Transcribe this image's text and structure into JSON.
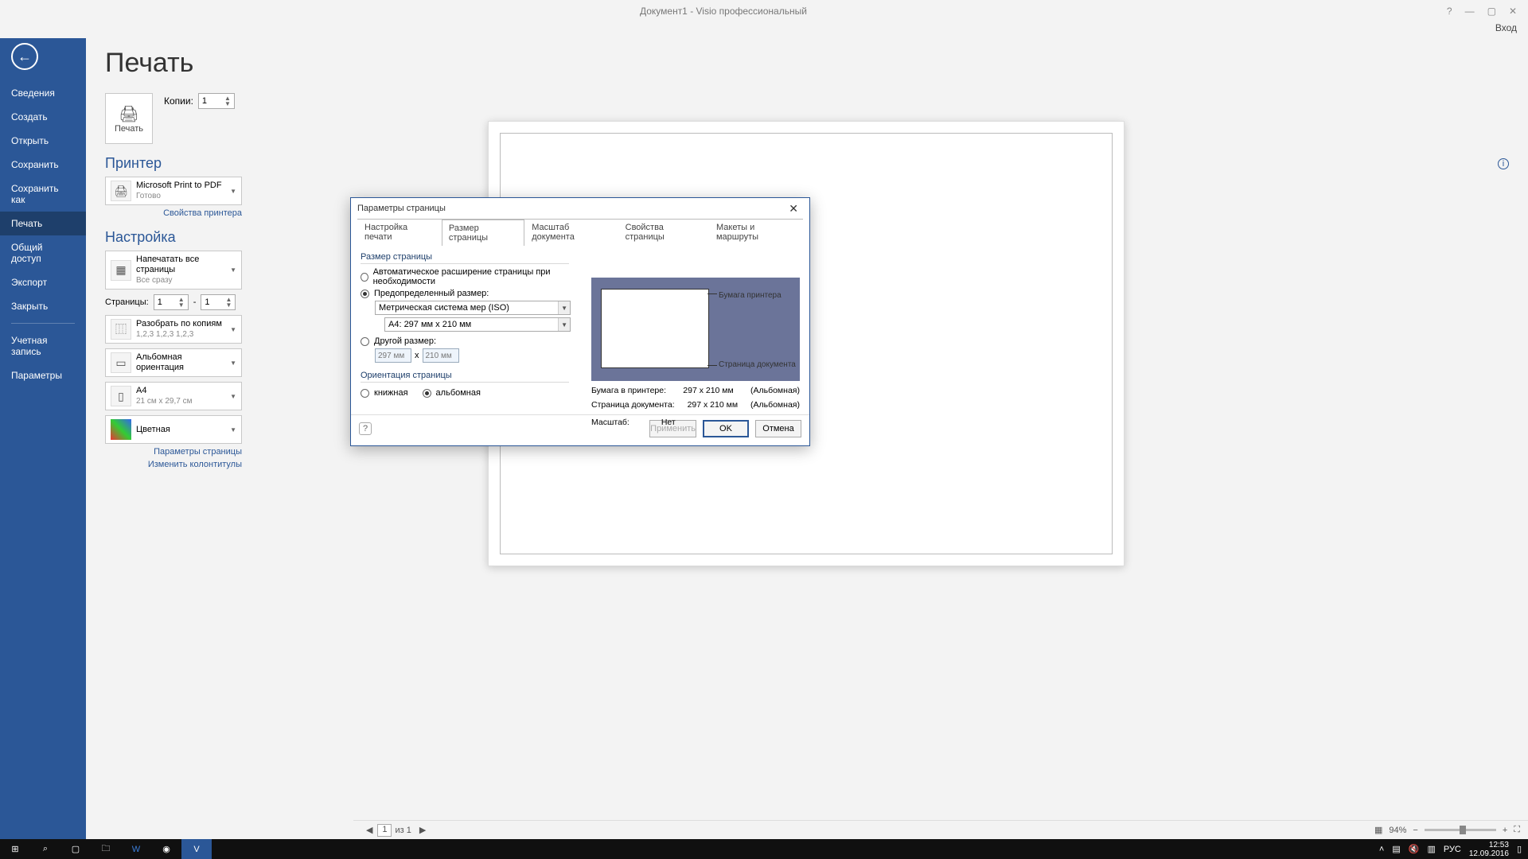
{
  "window": {
    "title": "Документ1 - Visio профессиональный",
    "help": "?",
    "login": "Вход"
  },
  "sidebar": {
    "items": [
      "Сведения",
      "Создать",
      "Открыть",
      "Сохранить",
      "Сохранить как",
      "Печать",
      "Общий доступ",
      "Экспорт",
      "Закрыть"
    ],
    "account": "Учетная запись",
    "options": "Параметры",
    "selected_index": 5
  },
  "print": {
    "heading": "Печать",
    "big_button": "Печать",
    "copies_label": "Копии:",
    "copies_value": "1",
    "printer_heading": "Принтер",
    "printer_name": "Microsoft Print to PDF",
    "printer_status": "Готово",
    "printer_props": "Свойства принтера",
    "setup_heading": "Настройка",
    "scope_main": "Напечатать все страницы",
    "scope_sub": "Все сразу",
    "pages_label": "Страницы:",
    "pages_from": "1",
    "pages_to": "1",
    "pages_dash": "-",
    "collate_main": "Разобрать по копиям",
    "collate_sub": "1,2,3   1,2,3   1,2,3",
    "orient_main": "Альбомная ориентация",
    "size_main": "A4",
    "size_sub": "21 см x 29,7 см",
    "color_main": "Цветная",
    "link_pageparams": "Параметры страницы",
    "link_headers": "Изменить колонтитулы"
  },
  "footer": {
    "page_value": "1",
    "page_of": "из 1",
    "zoom": "94%"
  },
  "dialog": {
    "title": "Параметры страницы",
    "tabs": [
      "Настройка печати",
      "Размер страницы",
      "Масштаб документа",
      "Свойства страницы",
      "Макеты и маршруты"
    ],
    "tab_selected": 1,
    "grp_size": "Размер страницы",
    "opt_auto": "Автоматическое расширение страницы при необходимости",
    "opt_predef": "Предопределенный размер:",
    "dd_system": "Метрическая система мер (ISO)",
    "dd_size": "A4:  297 мм x 210 мм",
    "opt_custom": "Другой размер:",
    "custom_w": "297 мм",
    "custom_h": "210 мм",
    "custom_x": "x",
    "grp_orient": "Ориентация страницы",
    "orient_portrait": "книжная",
    "orient_landscape": "альбомная",
    "pv_printer_paper": "Бумага принтера",
    "pv_doc_page": "Страница документа",
    "info_paper_label": "Бумага в принтере:",
    "info_paper_val": "297 x 210 мм",
    "info_paper_orient": "(Альбомная)",
    "info_doc_label": "Страница документа:",
    "info_doc_val": "297 x 210 мм",
    "info_doc_orient": "(Альбомная)",
    "info_scale_label": "Масштаб:",
    "info_scale_val": "Нет",
    "btn_apply": "Применить",
    "btn_ok": "OK",
    "btn_cancel": "Отмена"
  },
  "taskbar": {
    "lang": "РУС",
    "time": "12:53",
    "date": "12.09.2016"
  }
}
